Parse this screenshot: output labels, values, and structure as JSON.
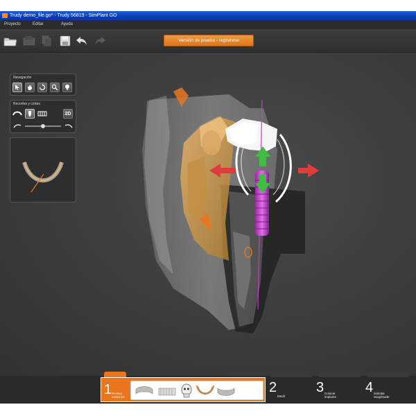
{
  "window": {
    "title": "Trudy demo_file.go* - Trudy 56819 - SimPlant GO"
  },
  "menu": {
    "items": [
      "Proyecto",
      "Editar",
      "Ayuda"
    ]
  },
  "toolbar": {
    "trial_label": "Versión de prueba - regístrese"
  },
  "panels": {
    "navigation": {
      "title": "Navegación"
    },
    "cuts": {
      "title": "Recortes y cortes",
      "mode_2d": "2D",
      "slider_value": 0.5
    }
  },
  "workflow": {
    "steps": [
      {
        "num": "1",
        "label_line1": "Revisar",
        "label_line2": "anatomía",
        "active": true
      },
      {
        "num": "2",
        "label_line1": "Medir",
        "label_line2": ""
      },
      {
        "num": "3",
        "label_line1": "Colocar",
        "label_line2": "implante"
      },
      {
        "num": "4",
        "label_line1": "Solicitar",
        "label_line2": "SurgiGuide"
      }
    ]
  },
  "colors": {
    "accent": "#e8761f",
    "implant": "#c040c8",
    "arrow_green": "#3fbf3f",
    "arrow_red": "#e23b3b"
  }
}
